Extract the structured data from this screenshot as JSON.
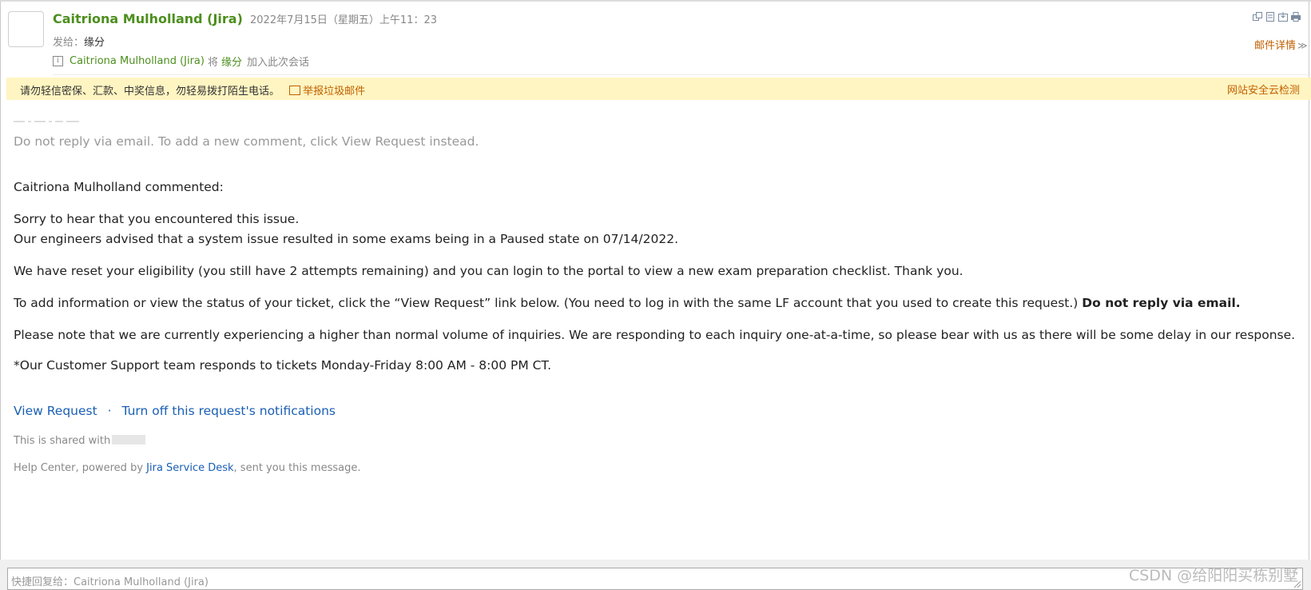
{
  "header": {
    "sender": "Caitriona Mulholland (Jira)",
    "date": "2022年7月15日（星期五）上午11：23",
    "to_label": "发给：",
    "to_name": "缘分",
    "conv_sender": "Caitriona Mulholland (Jira)",
    "conv_middle": "将",
    "conv_name": "缘分",
    "conv_suffix": "加入此次会话",
    "details": "邮件详情",
    "icons": [
      "window-icon",
      "note-icon",
      "save-icon",
      "print-icon"
    ]
  },
  "warning": {
    "text": "请勿轻信密保、汇款、中奖信息，勿轻易拨打陌生电话。",
    "report": "举报垃圾邮件",
    "security": "网站安全云检测"
  },
  "body": {
    "separator": "—-—-—-—",
    "do_not_reply": "Do not reply via email. To add a new comment, click View Request instead.",
    "commented": "Caitriona Mulholland commented:",
    "p1": "Sorry to hear that you encountered this issue.",
    "p2": "Our engineers advised that a system issue resulted in some exams being in a Paused state on 07/14/2022.",
    "p3": "We have reset your eligibility (you still have 2 attempts remaining) and you can login to the portal to view a new exam preparation checklist. Thank you.",
    "p4": "To add information or view the status of your ticket, click the “View Request” link below. (You need to log in with the same LF account that you used to create this request.)",
    "p4_bold": "Do not reply via email.",
    "p5": "Please note that we are currently experiencing a higher than normal volume of inquiries. We are responding to each inquiry one-at-a-time, so please bear with us as there will be some delay in our response.",
    "p6": "*Our Customer Support team responds to tickets Monday-Friday 8:00 AM - 8:00 PM CT.",
    "link_view": "View Request",
    "link_sep": "·",
    "link_turnoff": "Turn off this request's notifications",
    "shared": "This is shared with",
    "powered_prefix": "Help Center, powered by",
    "powered_link": "Jira Service Desk",
    "powered_suffix": ", sent you this message."
  },
  "reply": {
    "placeholder": "快捷回复给：Caitriona Mulholland (Jira)"
  },
  "watermark": "CSDN @给阳阳买栋别墅"
}
